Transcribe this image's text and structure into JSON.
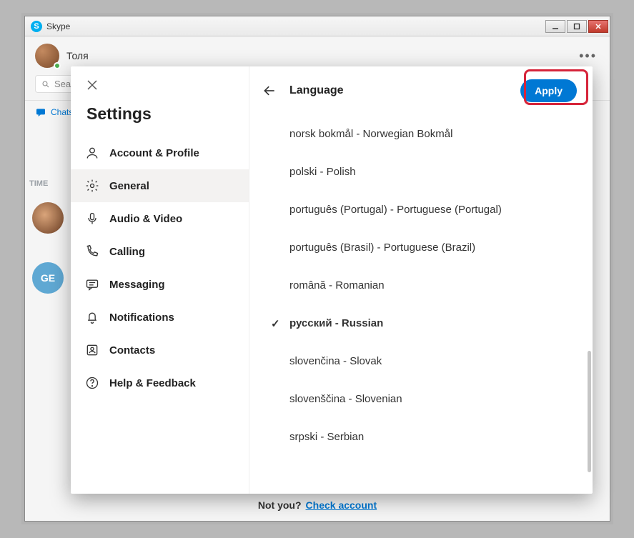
{
  "window": {
    "title": "Skype",
    "app_glyph": "S"
  },
  "background": {
    "profile_name": "Толя",
    "search_text": "Sea",
    "chats_tab": "Chats",
    "time_label": "TIME",
    "contact2_initials": "GE",
    "not_you": "Not you?",
    "check_account": "Check account"
  },
  "settings": {
    "title": "Settings",
    "nav": [
      {
        "key": "account",
        "label": "Account & Profile"
      },
      {
        "key": "general",
        "label": "General"
      },
      {
        "key": "audio-video",
        "label": "Audio & Video"
      },
      {
        "key": "calling",
        "label": "Calling"
      },
      {
        "key": "messaging",
        "label": "Messaging"
      },
      {
        "key": "notifications",
        "label": "Notifications"
      },
      {
        "key": "contacts",
        "label": "Contacts"
      },
      {
        "key": "help",
        "label": "Help & Feedback"
      }
    ],
    "active_nav": "general"
  },
  "detail": {
    "title": "Language",
    "apply_label": "Apply",
    "selected": "русский - Russian",
    "languages": [
      "norsk bokmål - Norwegian Bokmål",
      "polski - Polish",
      "português (Portugal) - Portuguese (Portugal)",
      "português (Brasil) - Portuguese (Brazil)",
      "română - Romanian",
      "русский - Russian",
      "slovenčina - Slovak",
      "slovenščina - Slovenian",
      "srpski - Serbian"
    ]
  }
}
